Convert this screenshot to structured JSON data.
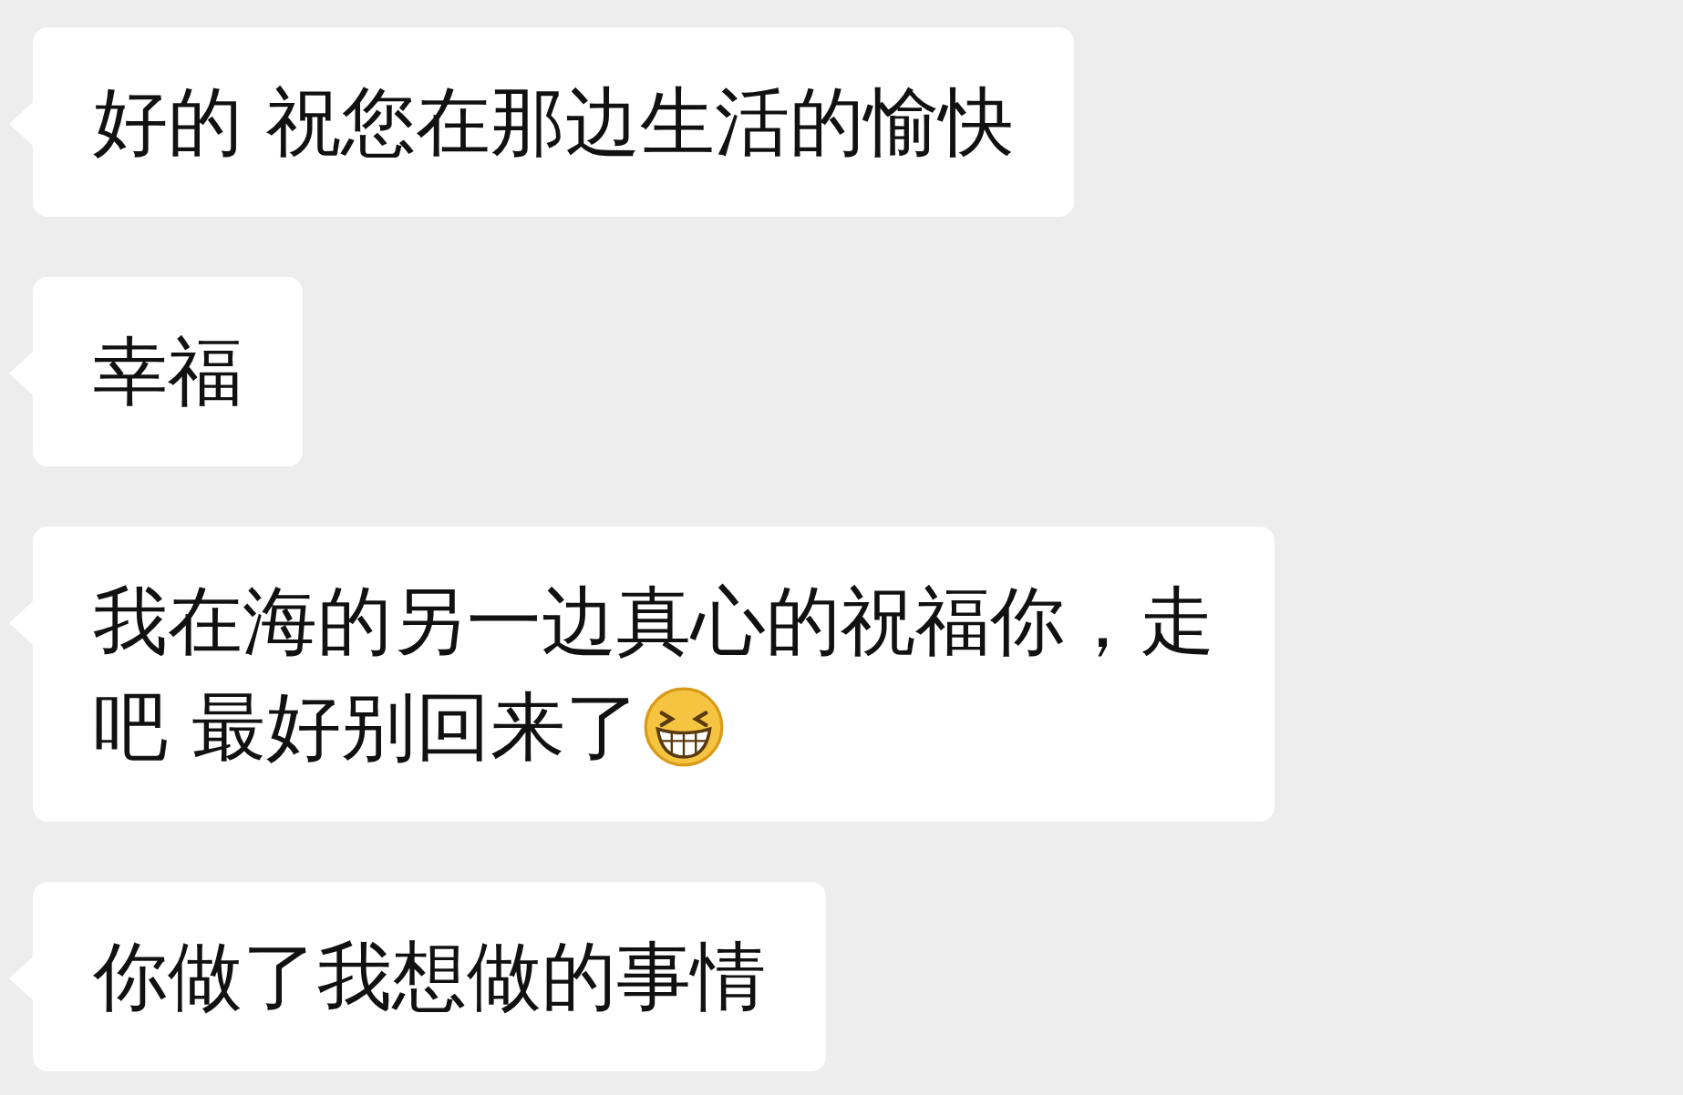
{
  "messages": [
    {
      "lines": [
        "好的 祝您在那边生活的愉快"
      ],
      "has_emoji": false
    },
    {
      "lines": [
        "幸福"
      ],
      "has_emoji": false
    },
    {
      "lines": [
        "我在海的另一边真心的祝福你，走",
        "吧 最好别回来了"
      ],
      "has_emoji": true
    },
    {
      "lines": [
        "你做了我想做的事情"
      ],
      "has_emoji": false
    }
  ]
}
